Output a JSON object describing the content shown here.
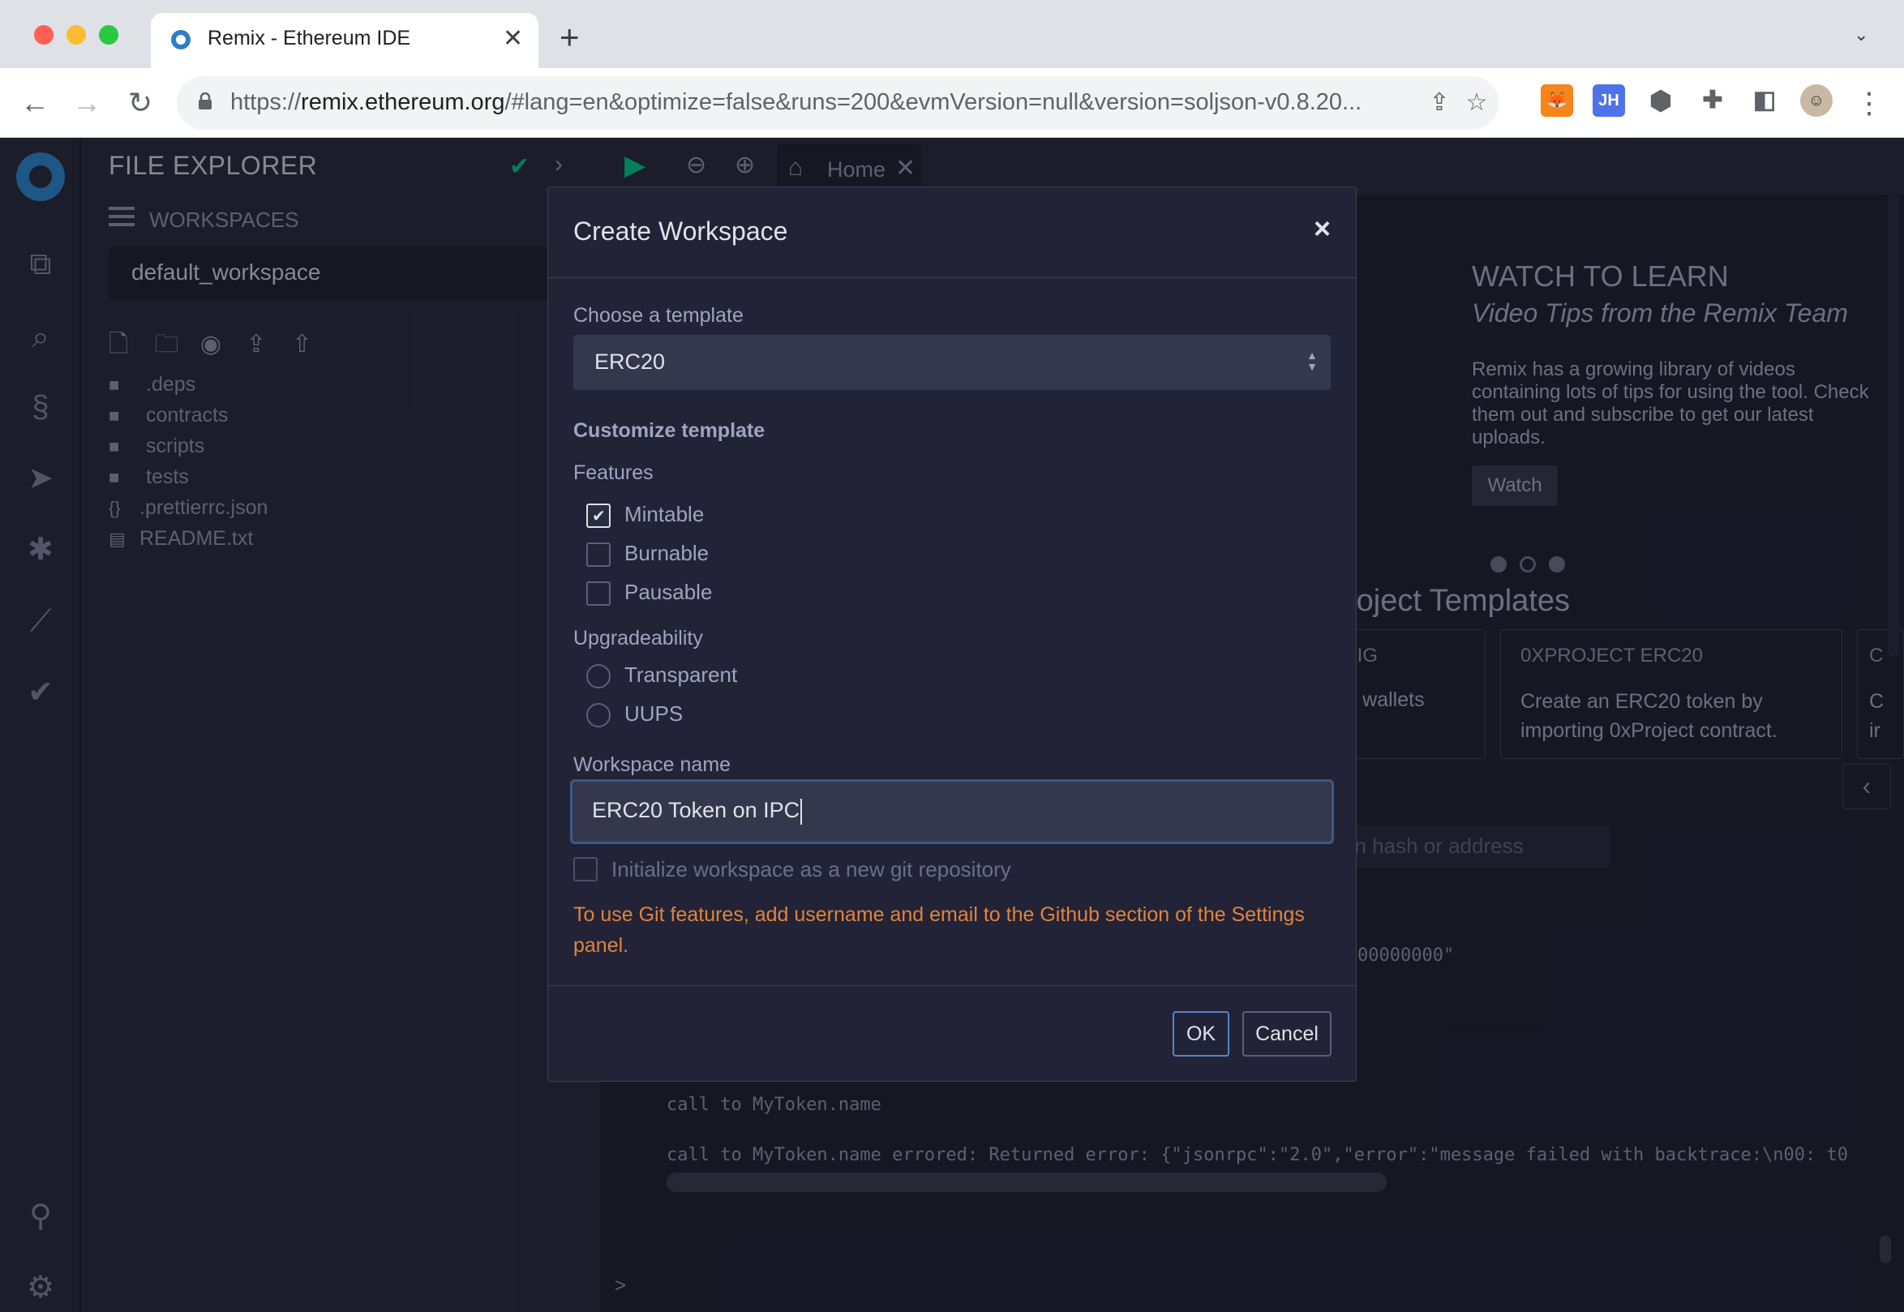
{
  "browser": {
    "tab_title": "Remix - Ethereum IDE",
    "url_prefix": "https://",
    "url_host": "remix.ethereum.org",
    "url_rest": "/#lang=en&optimize=false&runs=200&evmVersion=null&version=soljson-v0.8.20...",
    "extensions": [
      "metamask-icon",
      "jh-icon",
      "cube-icon",
      "puzzle-icon",
      "sidepanel-icon"
    ],
    "jh_label": "JH"
  },
  "sidepanel": {
    "title": "FILE EXPLORER",
    "workspaces_label": "WORKSPACES",
    "workspace_selected": "default_workspace",
    "tree": [
      {
        "name": ".deps",
        "type": "folder"
      },
      {
        "name": "contracts",
        "type": "folder"
      },
      {
        "name": "scripts",
        "type": "folder"
      },
      {
        "name": "tests",
        "type": "folder"
      },
      {
        "name": ".prettierrc.json",
        "type": "json"
      },
      {
        "name": "README.txt",
        "type": "file"
      }
    ]
  },
  "main": {
    "home_tab": "Home",
    "watch_title": "WATCH TO LEARN",
    "watch_subtitle": "Video Tips from the Remix Team",
    "watch_desc": "Remix has a growing library of videos containing lots of tips for using the tool. Check them out and subscribe to get our latest uploads.",
    "watch_button": "Watch",
    "project_templates": "roject Templates",
    "card1_title": "ISIG",
    "card1_text": "re wallets",
    "card2_title": "0XPROJECT ERC20",
    "card2_text": "Create an ERC20 token by importing 0xProject contract.",
    "card3_title": "C",
    "card3_text": "C\nir",
    "hash_placeholder": "on hash or address",
    "console_line0": "00000000\"",
    "console_line1": "call to MyToken.name",
    "console_line2": "call to MyToken.name errored: Returned error: {\"jsonrpc\":\"2.0\",\"error\":\"message failed with backtrace:\\n00: t0",
    "prompt": ">"
  },
  "modal": {
    "title": "Create Workspace",
    "close": "×",
    "template_label": "Choose a template",
    "template_value": "ERC20",
    "customize_label": "Customize template",
    "features_label": "Features",
    "features": [
      {
        "label": "Mintable",
        "checked": true
      },
      {
        "label": "Burnable",
        "checked": false
      },
      {
        "label": "Pausable",
        "checked": false
      }
    ],
    "upgradeability_label": "Upgradeability",
    "upgrade_options": [
      "Transparent",
      "UUPS"
    ],
    "workspace_name_label": "Workspace name",
    "workspace_name_value": "ERC20 Token on IPC",
    "git_init_label": "Initialize workspace as a new git repository",
    "git_note": "To use Git features, add username and email to the Github section of the Settings panel.",
    "ok": "OK",
    "cancel": "Cancel"
  },
  "colors": {
    "accent_orange": "#e0843e",
    "check_green": "#00bc8c",
    "focus_blue": "#5a84c5"
  }
}
